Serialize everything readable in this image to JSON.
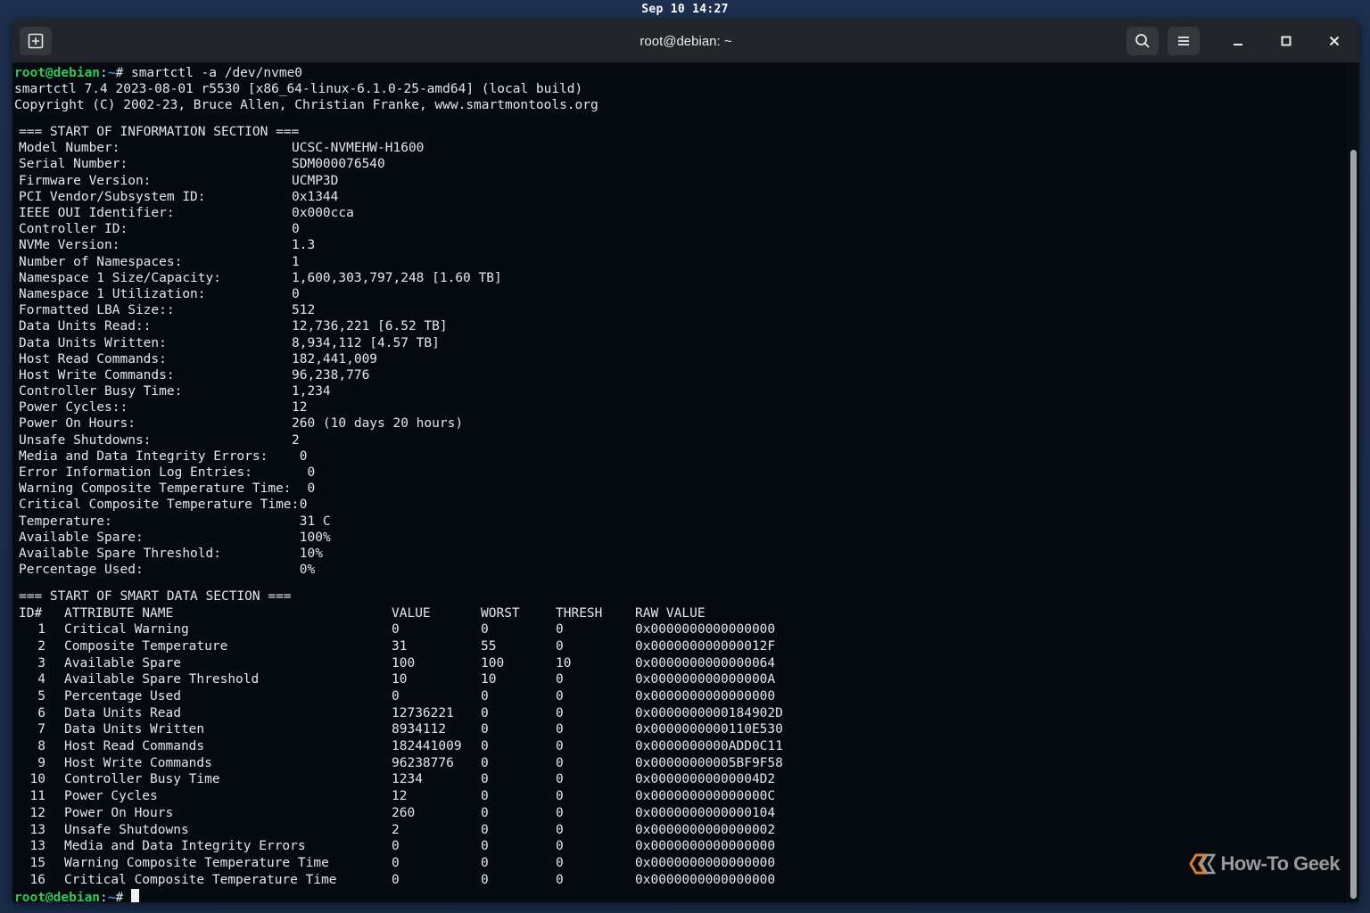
{
  "system": {
    "clock": "Sep 10 14:27"
  },
  "window": {
    "title": "root@debian: ~"
  },
  "prompt": {
    "user_host": "root@debian",
    "sep": ":",
    "path": "~",
    "symbol": "# "
  },
  "command": "smartctl -a /dev/nvme0",
  "header_lines": [
    "smartctl 7.4 2023-08-01 r5530 [x86_64-linux-6.1.0-25-amd64] (local build)",
    "Copyright (C) 2002-23, Bruce Allen, Christian Franke, www.smartmontools.org"
  ],
  "info_section": {
    "heading": "=== START OF INFORMATION SECTION ===",
    "rows": [
      {
        "key": "Model Number:",
        "value": "UCSC-NVMEHW-H1600"
      },
      {
        "key": "Serial Number:",
        "value": "SDM000076540"
      },
      {
        "key": "Firmware Version:",
        "value": "UCMP3D"
      },
      {
        "key": "PCI Vendor/Subsystem ID:",
        "value": "0x1344"
      },
      {
        "key": "IEEE OUI Identifier:",
        "value": "0x000cca"
      },
      {
        "key": "Controller ID:",
        "value": "0"
      },
      {
        "key": "NVMe Version:",
        "value": "1.3"
      },
      {
        "key": "Number of Namespaces:",
        "value": "1"
      },
      {
        "key": "Namespace 1 Size/Capacity:",
        "value": "1,600,303,797,248 [1.60 TB]"
      },
      {
        "key": "Namespace 1 Utilization:",
        "value": "0"
      },
      {
        "key": "Formatted LBA Size::",
        "value": "512"
      },
      {
        "key": "Data Units Read::",
        "value": "12,736,221 [6.52 TB]"
      },
      {
        "key": "Data Units Written:",
        "value": "8,934,112 [4.57 TB]"
      },
      {
        "key": "Host Read Commands:",
        "value": "182,441,009"
      },
      {
        "key": "Host Write Commands:",
        "value": "96,238,776"
      },
      {
        "key": "Controller Busy Time:",
        "value": "1,234"
      },
      {
        "key": "Power Cycles::",
        "value": "12"
      },
      {
        "key": "Power On Hours:",
        "value": "260 (10 days 20 hours)"
      },
      {
        "key": "Unsafe Shutdowns:",
        "value": "2"
      },
      {
        "key": "Media and Data Integrity Errors:",
        "value": " 0"
      },
      {
        "key": "Error Information Log Entries:",
        "value": "  0"
      },
      {
        "key": "Warning Composite Temperature Time:",
        "value": "  0"
      },
      {
        "key": "Critical Composite Temperature Time:",
        "value": " 0"
      },
      {
        "key": "Temperature:",
        "value": " 31 C"
      },
      {
        "key": "Available Spare:",
        "value": " 100%"
      },
      {
        "key": "Available Spare Threshold:",
        "value": " 10%"
      },
      {
        "key": "Percentage Used:",
        "value": " 0%"
      }
    ]
  },
  "smart_section": {
    "heading": "=== START OF SMART DATA SECTION ===",
    "columns": {
      "id": "ID#",
      "name": "ATTRIBUTE NAME",
      "value": "VALUE",
      "worst": "WORST",
      "thresh": "THRESH",
      "raw": "RAW VALUE"
    },
    "rows": [
      {
        "id": "1",
        "name": "Critical Warning",
        "value": "0",
        "worst": "0",
        "thresh": "0",
        "raw": "0x0000000000000000"
      },
      {
        "id": "2",
        "name": "Composite Temperature",
        "value": "31",
        "worst": "55",
        "thresh": "0",
        "raw": "0x000000000000012F"
      },
      {
        "id": "3",
        "name": "Available Spare",
        "value": "100",
        "worst": "100",
        "thresh": "10",
        "raw": "0x0000000000000064"
      },
      {
        "id": "4",
        "name": "Available Spare Threshold",
        "value": "10",
        "worst": "10",
        "thresh": "0",
        "raw": "0x000000000000000A"
      },
      {
        "id": "5",
        "name": "Percentage Used",
        "value": "0",
        "worst": "0",
        "thresh": "0",
        "raw": "0x0000000000000000"
      },
      {
        "id": "6",
        "name": "Data Units Read",
        "value": "12736221",
        "worst": "0",
        "thresh": "0",
        "raw": "0x0000000000184902D"
      },
      {
        "id": "7",
        "name": "Data Units Written",
        "value": "8934112",
        "worst": "0",
        "thresh": "0",
        "raw": "0x0000000000110E530"
      },
      {
        "id": "8",
        "name": "Host Read Commands",
        "value": "182441009",
        "worst": "0",
        "thresh": "0",
        "raw": "0x0000000000ADD0C11"
      },
      {
        "id": "9",
        "name": "Host Write Commands",
        "value": "96238776",
        "worst": "0",
        "thresh": "0",
        "raw": "0x00000000005BF9F58"
      },
      {
        "id": "10",
        "name": "Controller Busy Time",
        "value": "1234",
        "worst": "0",
        "thresh": "0",
        "raw": "0x00000000000004D2"
      },
      {
        "id": "11",
        "name": "Power Cycles",
        "value": "12",
        "worst": "0",
        "thresh": "0",
        "raw": "0x000000000000000C"
      },
      {
        "id": "12",
        "name": "Power On Hours",
        "value": "260",
        "worst": "0",
        "thresh": "0",
        "raw": "0x0000000000000104"
      },
      {
        "id": "13",
        "name": "Unsafe Shutdowns",
        "value": "2",
        "worst": "0",
        "thresh": "0",
        "raw": "0x0000000000000002"
      },
      {
        "id": "13",
        "name": "Media and Data Integrity Errors",
        "value": "0",
        "worst": "0",
        "thresh": "0",
        "raw": "0x0000000000000000"
      },
      {
        "id": "15",
        "name": "Warning Composite Temperature Time",
        "value": "0",
        "worst": "0",
        "thresh": "0",
        "raw": "0x0000000000000000"
      },
      {
        "id": "16",
        "name": "Critical Composite Temperature Time",
        "value": "0",
        "worst": "0",
        "thresh": "0",
        "raw": "0x0000000000000000"
      }
    ]
  },
  "watermark": {
    "text": "How-To Geek",
    "icon": "htg-logo-icon"
  },
  "icons": {
    "new_tab": "new-tab-icon",
    "search": "search-icon",
    "menu": "hamburger-menu-icon",
    "minimize": "minimize-icon",
    "maximize": "maximize-icon",
    "close": "close-icon"
  },
  "colors": {
    "prompt_user": "#34c759",
    "prompt_path": "#3b8eea",
    "terminal_bg": "#060b12",
    "titlebar_bg": "#222529"
  }
}
